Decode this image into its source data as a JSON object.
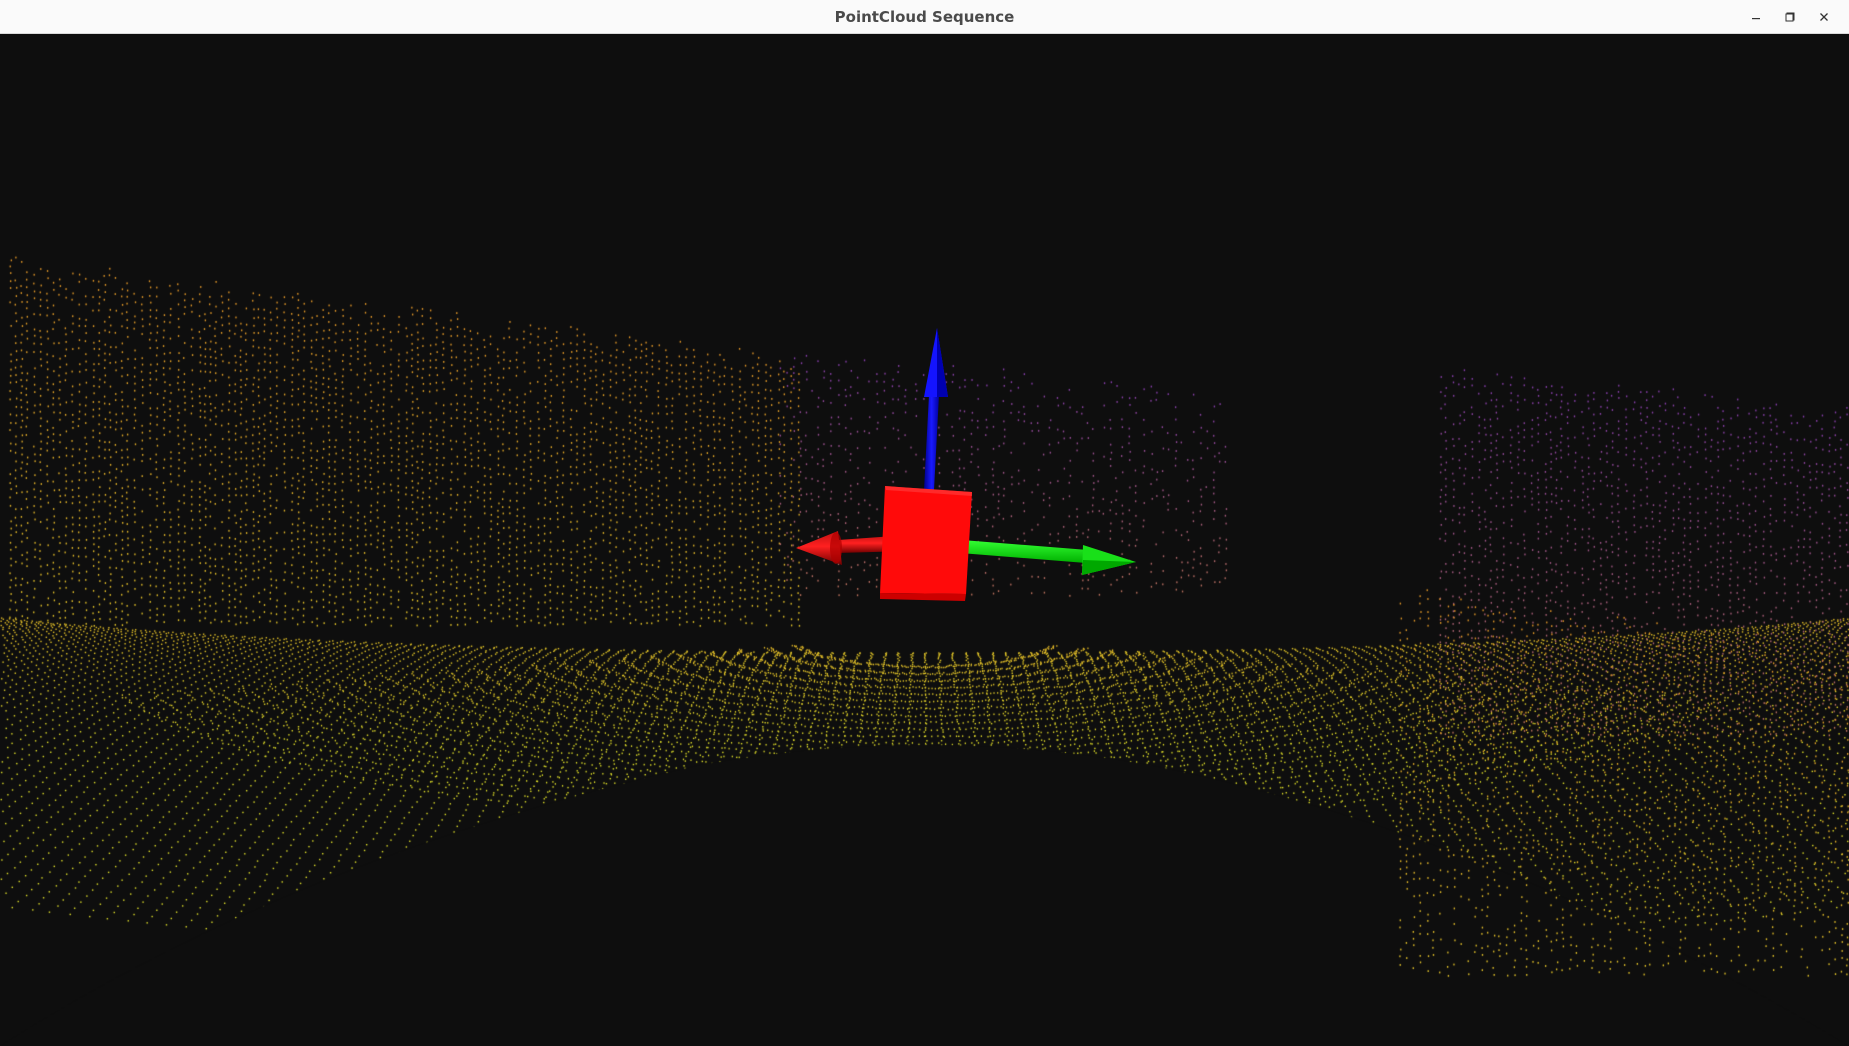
{
  "window": {
    "title": "PointCloud Sequence",
    "controls": {
      "minimize_icon": "minimize-icon",
      "maximize_icon": "maximize-icon",
      "close_icon": "close-icon"
    }
  },
  "viewer": {
    "background_color": "#0e0e0e",
    "point_colors": {
      "near": "#e6e62a",
      "mid": "#e89a28",
      "far": "#8a3fb0"
    },
    "axis_colors": {
      "x_axis": "#ff0000",
      "y_axis": "#00ff00",
      "z_axis": "#0000ff"
    },
    "marker_color": "#ff0000"
  }
}
